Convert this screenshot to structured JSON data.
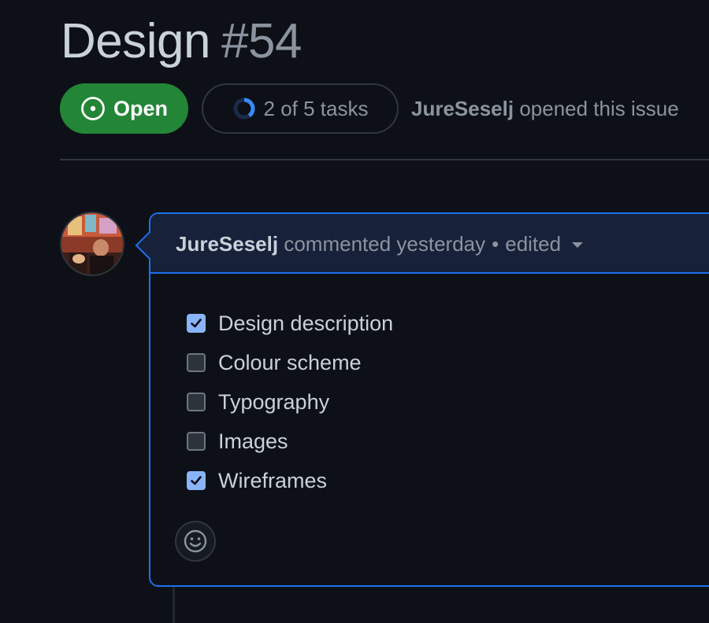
{
  "issue": {
    "title": "Design",
    "number": "#54",
    "state": "Open",
    "tasks_progress": "2 of 5 tasks",
    "tasks_done": 2,
    "tasks_total": 5,
    "opened_by": "JureSeselj",
    "opened_text": "opened this issue"
  },
  "comment": {
    "author": "JureSeselj",
    "action": "commented yesterday",
    "separator": "•",
    "edited_label": "edited",
    "tasks": [
      {
        "label": "Design description",
        "checked": true
      },
      {
        "label": "Colour scheme",
        "checked": false
      },
      {
        "label": "Typography",
        "checked": false
      },
      {
        "label": "Images",
        "checked": false
      },
      {
        "label": "Wireframes",
        "checked": true
      }
    ]
  },
  "icons": {
    "state": "issue-open-icon",
    "progress": "progress-ring-icon",
    "reaction": "smiley-icon",
    "edited_menu": "caret-down-icon"
  },
  "colors": {
    "background": "#0d1117",
    "open_badge": "#238636",
    "accent_border": "#1f6feb",
    "header_bg": "#172139",
    "checkbox_checked": "#8ab4f8"
  }
}
